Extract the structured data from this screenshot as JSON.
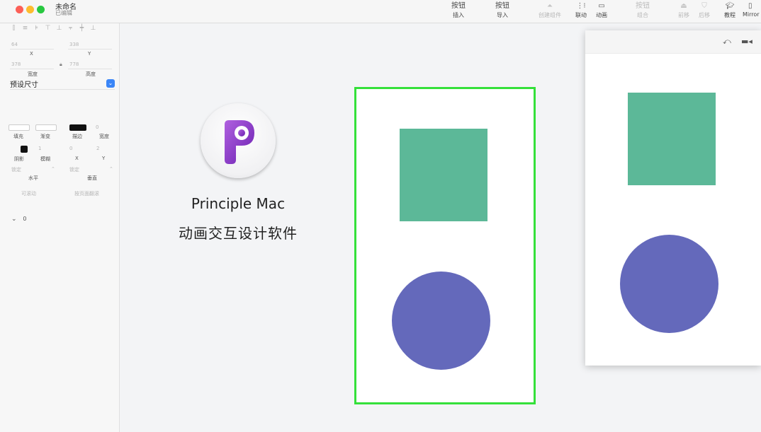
{
  "window": {
    "title": "未命名",
    "subtitle": "已编辑"
  },
  "toolbar": {
    "tools": [
      {
        "name": "insert",
        "top": "按钮",
        "label": "插入",
        "enabled": true
      },
      {
        "name": "import",
        "top": "按钮",
        "label": "导入",
        "enabled": true
      },
      {
        "name": "create-component",
        "icon": "triangle-stack-icon",
        "label": "创建组件",
        "enabled": false
      },
      {
        "name": "drive",
        "icon": "drive-icon",
        "label": "联动",
        "enabled": true
      },
      {
        "name": "animate",
        "icon": "screen-icon",
        "label": "动画",
        "enabled": true
      },
      {
        "name": "group",
        "top": "按钮",
        "label": "组合",
        "enabled": false
      },
      {
        "name": "front",
        "icon": "front-icon",
        "label": "前移",
        "enabled": false
      },
      {
        "name": "back",
        "icon": "back-icon",
        "label": "后移",
        "enabled": false
      },
      {
        "name": "tutorial",
        "icon": "mortarboard-icon",
        "label": "教程",
        "enabled": true
      },
      {
        "name": "mirror",
        "icon": "phone-icon",
        "label": "Mirror",
        "enabled": true
      }
    ]
  },
  "inspector": {
    "x_value": "64",
    "x_label": "X",
    "y_value": "338",
    "y_label": "Y",
    "width_value": "378",
    "width_label": "宽度",
    "height_value": "778",
    "height_label": "高度",
    "preset": "预设尺寸",
    "fill_label": "填充",
    "gradient_label": "渐变",
    "stroke_label": "描边",
    "stroke_width_label": "宽度",
    "stroke_width_value": "0",
    "shadow_label": "阴影",
    "blur_label": "模糊",
    "shadow_x_label": "X",
    "shadow_y_label": "Y",
    "blur_value": "1",
    "shadow_x_value": "0",
    "shadow_y_value": "2",
    "opacity_label": "水平",
    "opacity_value": "锁定",
    "vertical_label": "垂直",
    "vertical_value": "锁定",
    "scroll_label": "可滚动",
    "page_label": "按页面翻滚",
    "tree_item": "0"
  },
  "promo": {
    "name": "Principle Mac",
    "description": "动画交互设计软件",
    "icon": "principle-logo-icon"
  },
  "colors": {
    "artboard_border": "#34e03a",
    "square": "#5cb898",
    "circle": "#6469bb",
    "toggle_blue": "#3b86f7"
  }
}
